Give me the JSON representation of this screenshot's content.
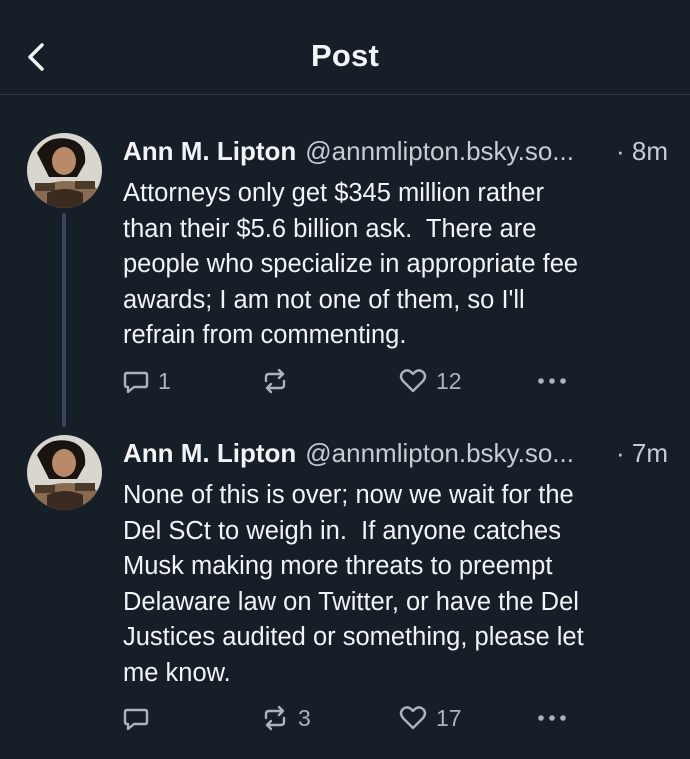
{
  "header": {
    "title": "Post",
    "back_icon": "chevron-left-icon"
  },
  "posts": [
    {
      "author": "Ann M. Lipton",
      "handle": "@annmlipton.bsky.so...",
      "time": "· 8m",
      "text": "Attorneys only get $345 million rather\nthan their $5.6 billion ask.  There are\npeople who specialize in appropriate fee\nawards; I am not one of them, so I'll\nrefrain from commenting.",
      "replies": "1",
      "reposts": "",
      "likes": "12"
    },
    {
      "author": "Ann M. Lipton",
      "handle": "@annmlipton.bsky.so...",
      "time": "· 7m",
      "text": "None of this is over; now we wait for the\nDel SCt to weigh in.  If anyone catches\nMusk making more threats to preempt\nDelaware law on Twitter, or have the Del\nJustices audited or something, please let\nme know.",
      "replies": "",
      "reposts": "3",
      "likes": "17"
    }
  ],
  "colors": {
    "background": "#161e27",
    "text": "#f1f3f5",
    "muted": "#aab4be",
    "thread_line": "#33475c"
  }
}
